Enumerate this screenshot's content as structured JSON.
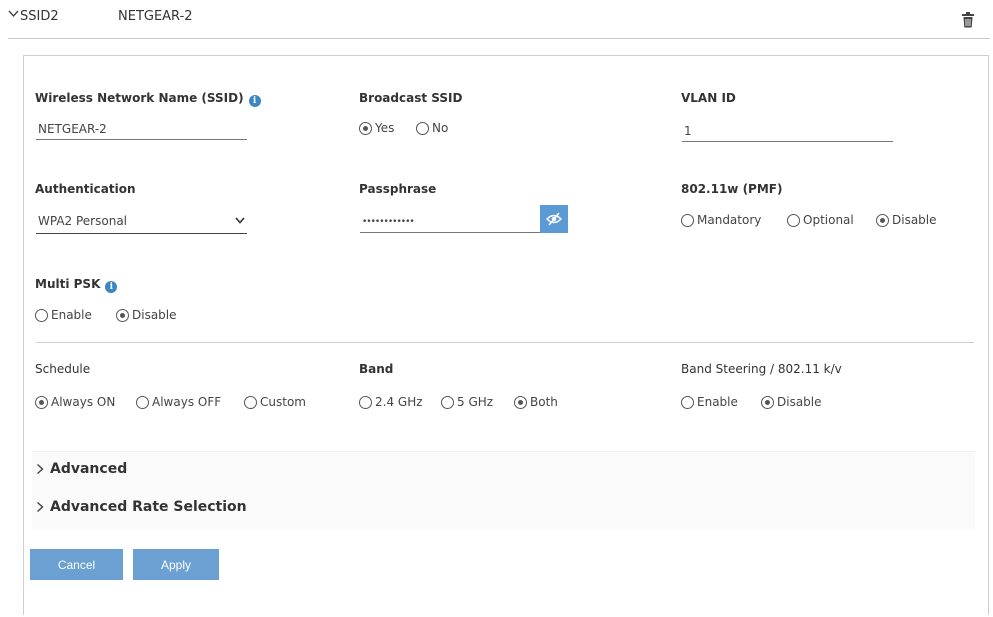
{
  "header": {
    "ssid_label": "SSID2",
    "ssid_name": "NETGEAR-2"
  },
  "ssid_field": {
    "label": "Wireless Network Name (SSID)",
    "value": "NETGEAR-2"
  },
  "broadcast": {
    "label": "Broadcast SSID",
    "options": [
      "Yes",
      "No"
    ],
    "selected": "Yes"
  },
  "vlan": {
    "label": "VLAN ID",
    "value": "1"
  },
  "authentication": {
    "label": "Authentication",
    "value": "WPA2 Personal"
  },
  "passphrase": {
    "label": "Passphrase",
    "masked": "••••••••••••"
  },
  "pmf": {
    "label": "802.11w (PMF)",
    "options": [
      "Mandatory",
      "Optional",
      "Disable"
    ],
    "selected": "Disable"
  },
  "multi_psk": {
    "label": "Multi PSK",
    "options": [
      "Enable",
      "Disable"
    ],
    "selected": "Disable"
  },
  "schedule": {
    "label": "Schedule",
    "options": [
      "Always ON",
      "Always OFF",
      "Custom"
    ],
    "selected": "Always ON"
  },
  "band": {
    "label": "Band",
    "options": [
      "2.4 GHz",
      "5 GHz",
      "Both"
    ],
    "selected": "Both"
  },
  "band_steering": {
    "label": "Band Steering / 802.11 k/v",
    "options": [
      "Enable",
      "Disable"
    ],
    "selected": "Disable"
  },
  "advanced": {
    "advanced_label": "Advanced",
    "rate_label": "Advanced Rate Selection"
  },
  "buttons": {
    "cancel": "Cancel",
    "apply": "Apply"
  },
  "colors": {
    "accent": "#6aa0d2",
    "info": "#3c86c4"
  }
}
